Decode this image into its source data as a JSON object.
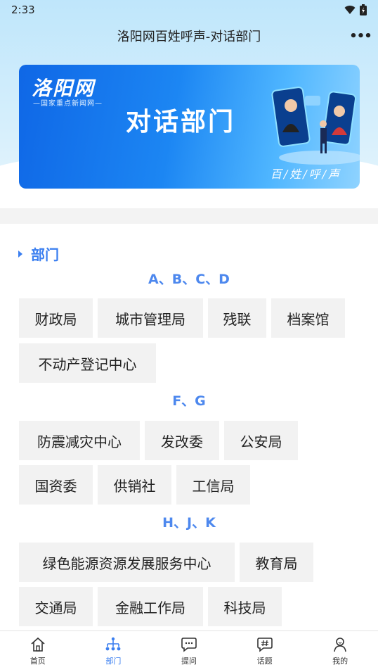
{
  "status": {
    "time": "2:33"
  },
  "header": {
    "title": "洛阳网百姓呼声-对话部门",
    "more": "•••"
  },
  "banner": {
    "logo": "洛阳网",
    "subtitle": "—国家重点新闻网—",
    "title": "对话部门",
    "slogan": "百/姓/呼/声"
  },
  "section": {
    "title": "部门"
  },
  "groups": [
    {
      "letters": "A、B、C、D",
      "items": [
        "财政局",
        "城市管理局",
        "残联",
        "档案馆",
        "不动产登记中心"
      ]
    },
    {
      "letters": "F、G",
      "items": [
        "防震减灾中心",
        "发改委",
        "公安局",
        "国资委",
        "供销社",
        "工信局"
      ]
    },
    {
      "letters": "H、J、K",
      "items": [
        "绿色能源资源发展服务中心",
        "教育局",
        "交通局",
        "金融工作局",
        "科技局"
      ]
    }
  ],
  "tabs": [
    {
      "label": "首页",
      "icon": "home-icon"
    },
    {
      "label": "部门",
      "icon": "org-chart-icon",
      "active": true
    },
    {
      "label": "提问",
      "icon": "chat-bubble-icon"
    },
    {
      "label": "话题",
      "icon": "hashtag-bubble-icon"
    },
    {
      "label": "我的",
      "icon": "user-icon"
    }
  ],
  "colors": {
    "accent": "#3b7ff0",
    "chip_bg": "#f2f2f2",
    "banner_blue": "#1c86f3"
  }
}
